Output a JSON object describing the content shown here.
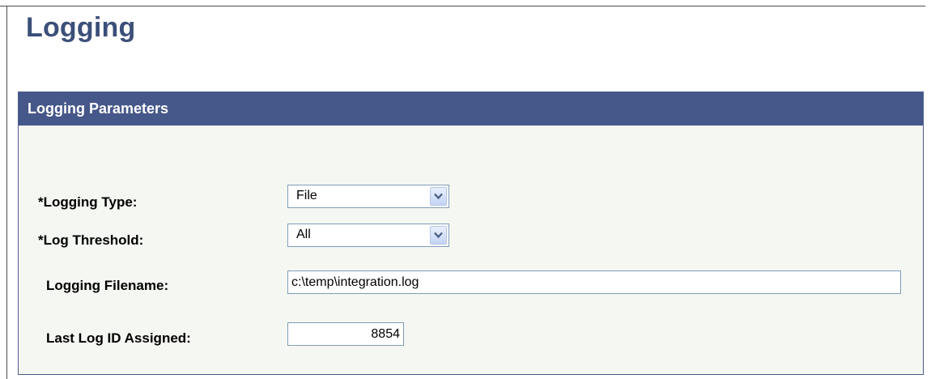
{
  "page": {
    "title": "Logging"
  },
  "group": {
    "title": "Logging Parameters"
  },
  "fields": {
    "logging_type": {
      "label": "*Logging Type:",
      "value": "File"
    },
    "log_threshold": {
      "label": "*Log Threshold:",
      "value": "All"
    },
    "logging_filename": {
      "label": "Logging Filename:",
      "value": "c:\\temp\\integration.log"
    },
    "last_log_id": {
      "label": "Last Log ID Assigned:",
      "value": "8854"
    }
  },
  "icons": {
    "dropdown": "chevron-down-icon"
  },
  "colors": {
    "title": "#3b4f78",
    "header_bg": "#465789",
    "group_bg": "#f5f7f2",
    "input_border": "#7f9db9"
  }
}
